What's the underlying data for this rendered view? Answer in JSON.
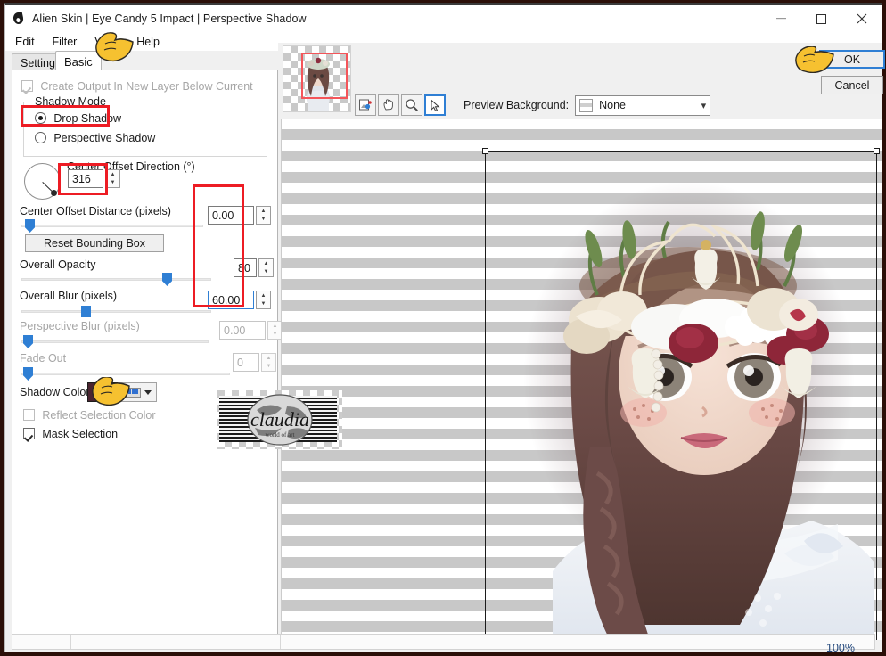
{
  "window": {
    "title": "Alien Skin | Eye Candy 5 Impact | Perspective Shadow",
    "icon": "droplet-icon",
    "minimize": "minimize-icon",
    "maximize": "maximize-icon",
    "close": "close-icon"
  },
  "menubar": {
    "items": [
      {
        "label": "Edit"
      },
      {
        "label": "Filter"
      },
      {
        "label": "View"
      },
      {
        "label": "Help"
      }
    ]
  },
  "tabs": [
    {
      "label": "Settings",
      "active": false
    },
    {
      "label": "Basic",
      "active": true
    }
  ],
  "panel": {
    "create_output": {
      "label": "Create Output In New Layer Below Current",
      "checked": true,
      "enabled": false
    },
    "shadow_mode": {
      "title": "Shadow Mode",
      "options": [
        {
          "label": "Drop Shadow",
          "selected": true
        },
        {
          "label": "Perspective Shadow",
          "selected": false
        }
      ]
    },
    "center_offset_direction": {
      "label": "Center Offset Direction (°)",
      "value": "316",
      "dial_angle_deg": 316
    },
    "center_offset_distance": {
      "label": "Center Offset Distance (pixels)",
      "value": "0.00",
      "slider_percent": 2
    },
    "reset_bounding_box": {
      "label": "Reset Bounding Box"
    },
    "overall_opacity": {
      "label": "Overall Opacity",
      "value": "80",
      "slider_percent": 78
    },
    "overall_blur": {
      "label": "Overall Blur (pixels)",
      "value": "60.00",
      "slider_percent": 33,
      "focused": true
    },
    "perspective_blur": {
      "label": "Perspective Blur (pixels)",
      "value": "0.00",
      "slider_percent": 1,
      "enabled": false
    },
    "fade_out": {
      "label": "Fade Out",
      "value": "0",
      "slider_percent": 1,
      "enabled": false
    },
    "shadow_color": {
      "label": "Shadow Color",
      "color": "#4a2430",
      "picker_icon": "color-picker-icon",
      "dropdown_icon": "chevron-down-icon"
    },
    "reflect_selection_color": {
      "label": "Reflect Selection Color",
      "checked": false,
      "enabled": false
    },
    "mask_selection": {
      "label": "Mask Selection",
      "checked": true,
      "enabled": true
    }
  },
  "preview": {
    "navigator": {
      "name": "navigator-thumbnail"
    },
    "tools": [
      {
        "name": "eyedropper-tool",
        "selected": false
      },
      {
        "name": "pan-hand-tool",
        "selected": false
      },
      {
        "name": "zoom-tool",
        "selected": false
      },
      {
        "name": "select-arrow-tool",
        "selected": true
      }
    ],
    "background_label": "Preview Background:",
    "background_value": "None",
    "background_swatch": "checkered-swatch-icon"
  },
  "actions": {
    "ok": "OK",
    "cancel": "Cancel"
  },
  "statusbar": {
    "zoom": "100%"
  },
  "annotations": {
    "cursor_icon": "pointing-hand-cursor",
    "highlight_color": "#ed1c24"
  },
  "watermark": {
    "text": "claudia"
  }
}
